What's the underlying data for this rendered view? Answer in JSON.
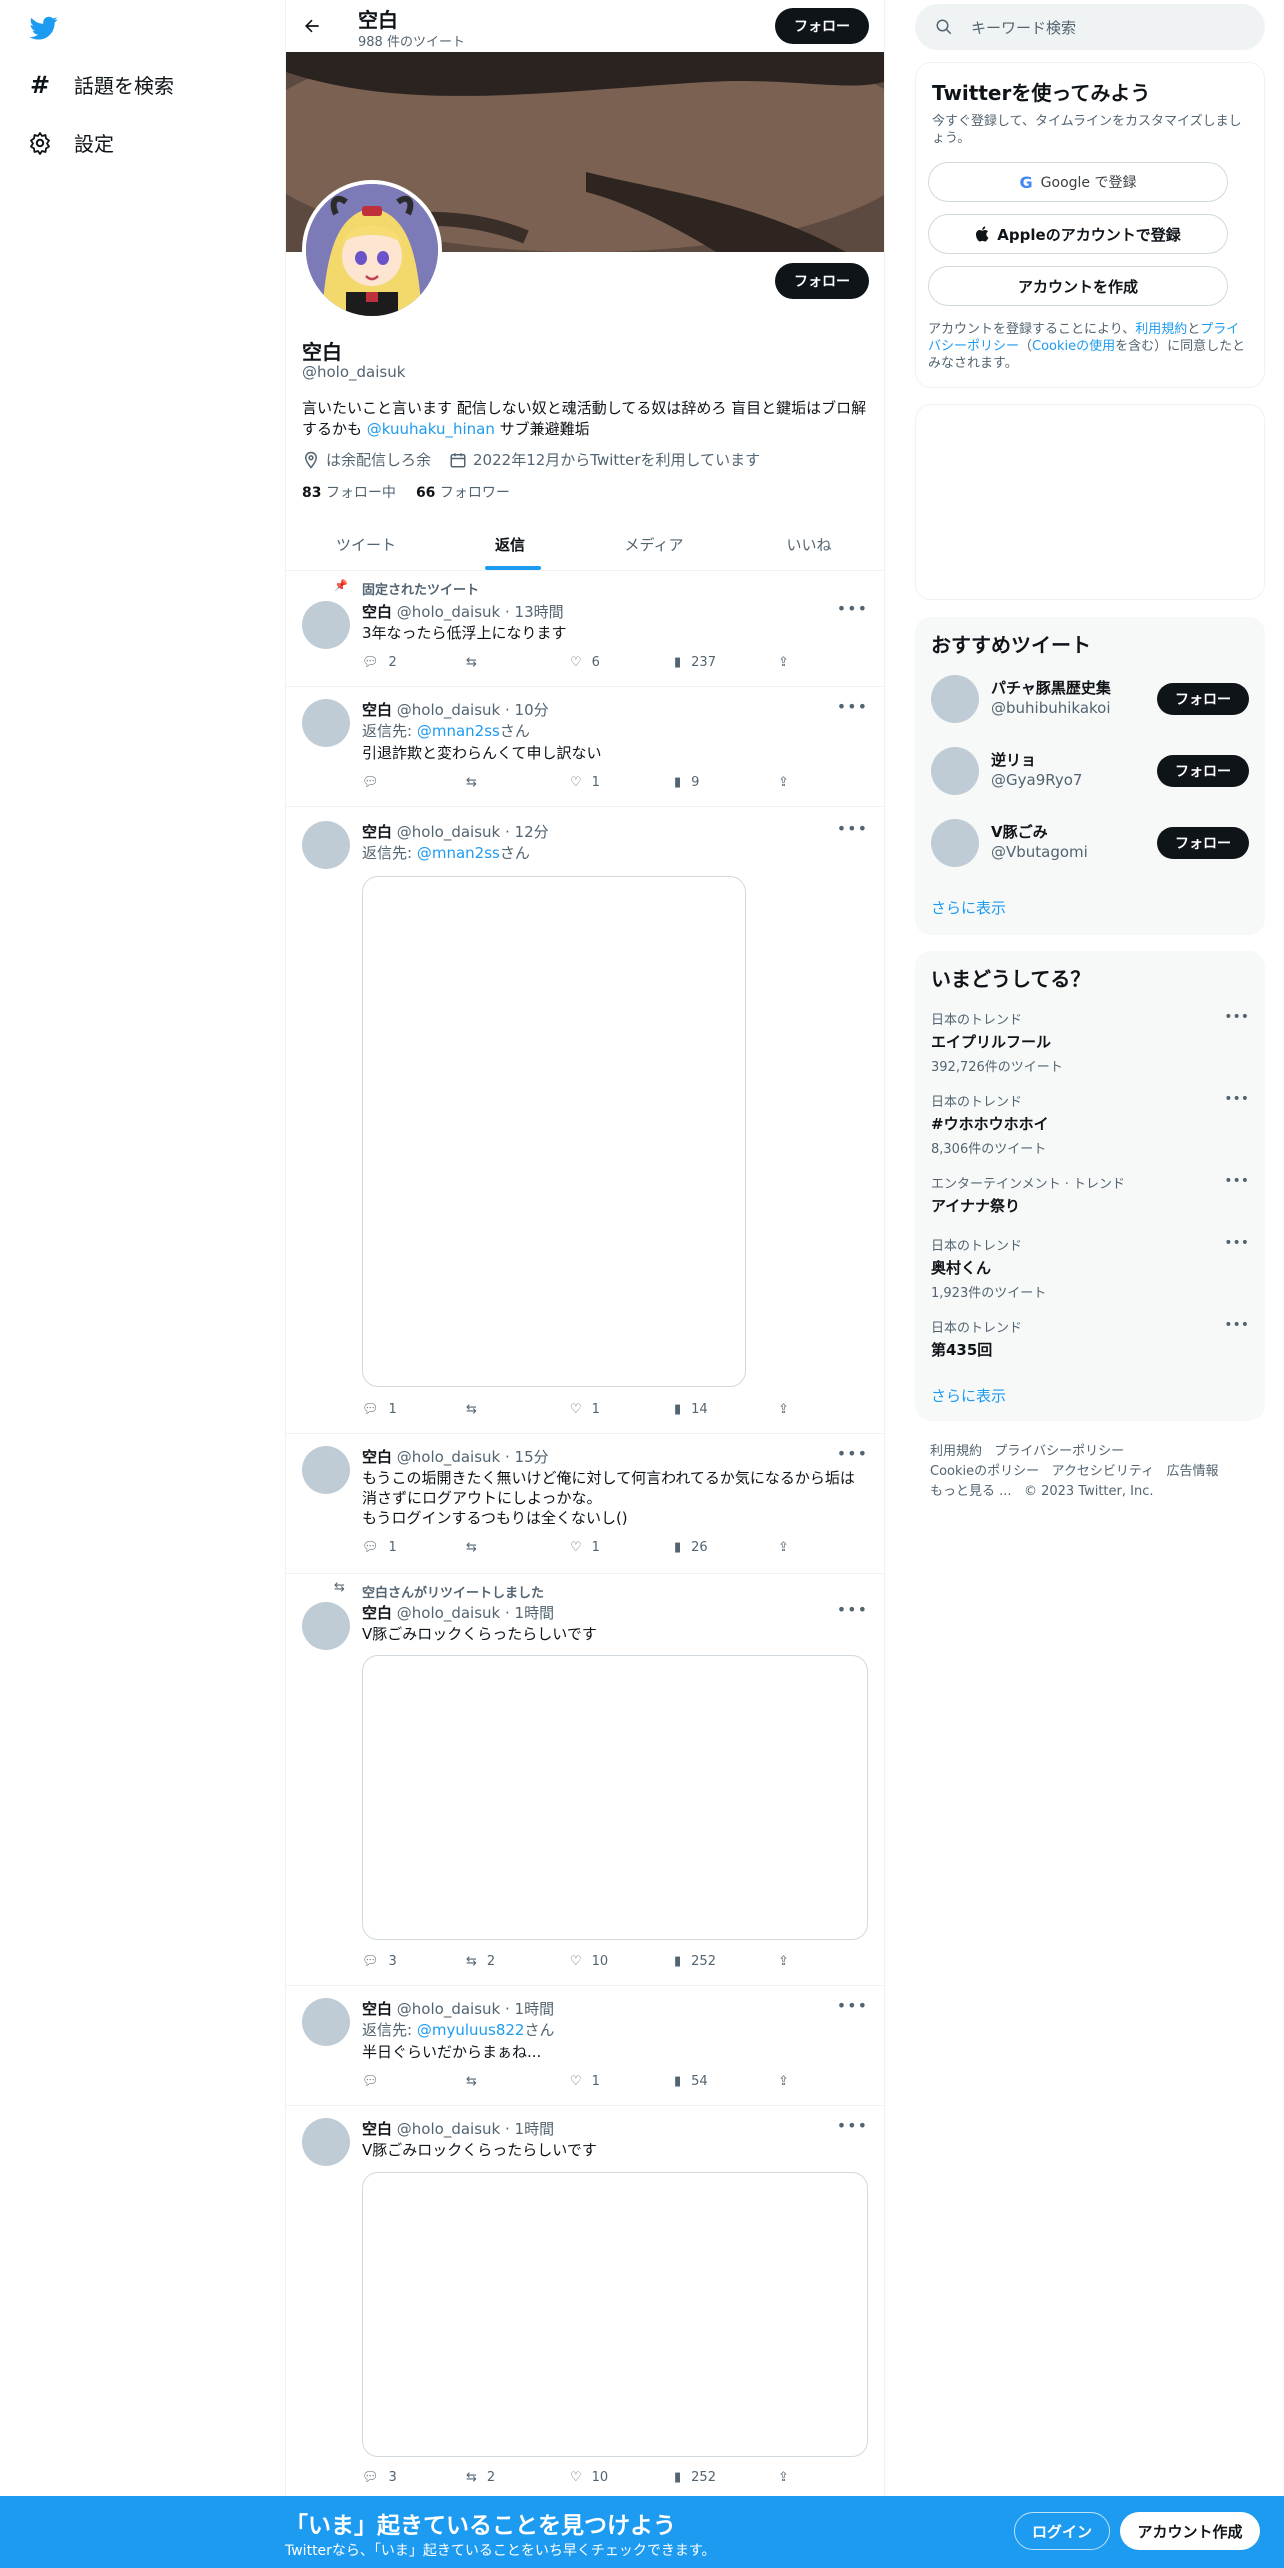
{
  "nav": {
    "search_label": "話題を検索",
    "settings_label": "設定"
  },
  "header": {
    "name": "空白",
    "tweet_count": "988 件のツイート",
    "follow": "フォロー"
  },
  "profile": {
    "follow": "フォロー",
    "name": "空白",
    "handle": "@holo_daisuk",
    "bio_part1": "言いたいこと言います 配信しない奴と魂活動してる奴は辞めろ 盲目と鍵垢はブロ解するかも ",
    "bio_mention": "@kuuhaku_hinan",
    "bio_part2": " サブ兼避難垢",
    "location": "は余配信しろ余",
    "joined": "2022年12月からTwitterを利用しています",
    "following_count": "83",
    "following_label": "フォロー中",
    "followers_count": "66",
    "followers_label": "フォロワー"
  },
  "tabs": [
    "ツイート",
    "返信",
    "メディア",
    "いいね"
  ],
  "tweets": [
    {
      "context": "固定されたツイート",
      "name": "空白",
      "meta": "@holo_daisuk · 13時間",
      "reply_prefix": "",
      "reply_to": "",
      "reply_suffix": "",
      "text": "3年なったら低浮上になります",
      "reply": "2",
      "retweet": "",
      "like": "6",
      "views": "237"
    },
    {
      "context": "",
      "name": "空白",
      "meta": "@holo_daisuk · 10分",
      "reply_prefix": "返信先: ",
      "reply_to": "@mnan2ss",
      "reply_suffix": "さん",
      "text": "引退詐欺と変わらんくて申し訳ない",
      "reply": "",
      "retweet": "",
      "like": "1",
      "views": "9"
    },
    {
      "context": "",
      "name": "空白",
      "meta": "@holo_daisuk · 12分",
      "reply_prefix": "返信先: ",
      "reply_to": "@mnan2ss",
      "reply_suffix": "さん",
      "text": "",
      "reply": "1",
      "retweet": "",
      "like": "1",
      "views": "14"
    },
    {
      "context": "",
      "name": "空白",
      "meta": "@holo_daisuk · 15分",
      "reply_prefix": "",
      "reply_to": "",
      "reply_suffix": "",
      "text_lines": [
        "もうこの垢開きたく無いけど俺に対して何言われてるか気になるから垢は",
        "消さずにログアウトにしよっかな。",
        "もうログインするつもりは全くないし()"
      ],
      "reply": "1",
      "retweet": "",
      "like": "1",
      "views": "26"
    },
    {
      "context": "空白さんがリツイートしました",
      "name": "空白",
      "meta": "@holo_daisuk · 1時間",
      "reply_prefix": "",
      "reply_to": "",
      "reply_suffix": "",
      "text": "V豚ごみロックくらったらしいです",
      "reply": "3",
      "retweet": "2",
      "like": "10",
      "views": "252"
    },
    {
      "context": "",
      "name": "空白",
      "meta": "@holo_daisuk · 1時間",
      "reply_prefix": "返信先: ",
      "reply_to": "@myuluus822",
      "reply_suffix": "さん",
      "text": "半日ぐらいだからまぁね...",
      "reply": "",
      "retweet": "",
      "like": "1",
      "views": "54"
    },
    {
      "context": "",
      "name": "空白",
      "meta": "@holo_daisuk · 1時間",
      "reply_prefix": "",
      "reply_to": "",
      "reply_suffix": "",
      "text": "V豚ごみロックくらったらしいです",
      "reply": "3",
      "retweet": "2",
      "like": "10",
      "views": "252"
    }
  ],
  "search": {
    "placeholder": "キーワード検索"
  },
  "signup": {
    "title": "Twitterを使ってみよう",
    "subtitle": "今すぐ登録して、タイムラインをカスタマイズしましょう。",
    "google": "Google で登録",
    "apple": "Appleのアカウントで登録",
    "create": "アカウントを作成",
    "terms_1": "アカウントを登録することにより、",
    "terms_link1": "利用規約",
    "terms_2": "と",
    "terms_link2": "プライバシーポリシー",
    "terms_3": "（",
    "terms_link3": "Cookieの使用",
    "terms_4": "を含む）に同意したとみなされます。"
  },
  "recommended": {
    "title": "おすすめツイート",
    "users": [
      {
        "name": "パチャ豚黒歴史集",
        "handle": "@buhibuhikakoi",
        "follow": "フォロー"
      },
      {
        "name": "逆リョ",
        "handle": "@Gya9Ryo7",
        "follow": "フォロー"
      },
      {
        "name": "V豚ごみ",
        "handle": "@Vbutagomi",
        "follow": "フォロー"
      }
    ],
    "more": "さらに表示"
  },
  "trends": {
    "title": "いまどうしてる？",
    "items": [
      {
        "category": "日本のトレンド",
        "name": "エイプリルフール",
        "count": "392,726件のツイート"
      },
      {
        "category": "日本のトレンド",
        "name": "#ウホホウホホイ",
        "count": "8,306件のツイート"
      },
      {
        "category": "エンターテインメント · トレンド",
        "name": "アイナナ祭り",
        "count": ""
      },
      {
        "category": "日本のトレンド",
        "name": "奥村くん",
        "count": "1,923件のツイート"
      },
      {
        "category": "日本のトレンド",
        "name": "第435回",
        "count": ""
      }
    ],
    "more": "さらに表示"
  },
  "footer": {
    "terms": "利用規約",
    "privacy": "プライバシーポリシー",
    "cookie": "Cookieのポリシー",
    "accessibility": "アクセシビリティ",
    "ads": "広告情報",
    "more": "もっと見る ...",
    "copyright": "© 2023 Twitter, Inc."
  },
  "bottom": {
    "title": "「いま」起きていることを見つけよう",
    "subtitle": "Twitterなら、「いま」起きていることをいち早くチェックできます。",
    "login": "ログイン",
    "signup": "アカウント作成"
  },
  "colors": {
    "accent": "#1d9bf0",
    "dark": "#0f1419",
    "gray": "#536471"
  }
}
